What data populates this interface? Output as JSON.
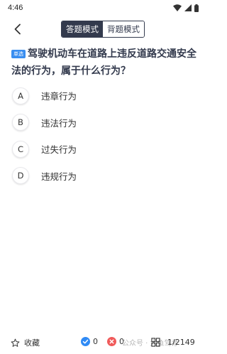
{
  "status_bar": {
    "time": "4:46"
  },
  "header": {
    "tabs": [
      {
        "label": "答题模式",
        "active": true
      },
      {
        "label": "背题模式",
        "active": false
      }
    ]
  },
  "question": {
    "type_badge": "单选",
    "text": "驾驶机动车在道路上违反道路交通安全法的行为，属于什么行为？"
  },
  "options": [
    {
      "letter": "A",
      "text": "违章行为"
    },
    {
      "letter": "B",
      "text": "违法行为"
    },
    {
      "letter": "C",
      "text": "过失行为"
    },
    {
      "letter": "D",
      "text": "违规行为"
    }
  ],
  "bottom_bar": {
    "favorite_label": "收藏",
    "correct_count": "0",
    "wrong_count": "0",
    "progress": "1/2149",
    "watermark": "公众号 · 大鱼驾考"
  },
  "colors": {
    "accent": "#333a4d",
    "badge": "#3a8ef0",
    "correct": "#2f8af5",
    "wrong": "#f05a5a"
  },
  "icons": [
    "back-arrow-icon",
    "wifi-icon",
    "signal-icon",
    "battery-icon",
    "star-icon",
    "check-circle-icon",
    "close-circle-icon",
    "grid-icon"
  ]
}
